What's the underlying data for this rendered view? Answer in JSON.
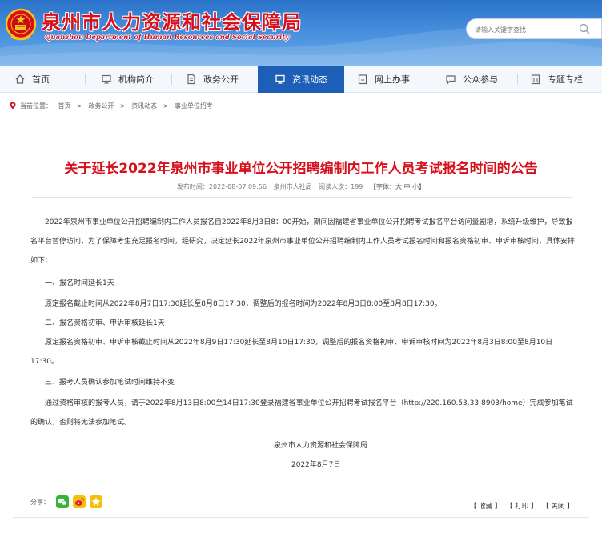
{
  "header": {
    "site_title": "泉州市人力资源和社会保障局",
    "site_subtitle": "Quanzhou Department of Human Resources and Social Security",
    "search_placeholder": "请输入关键字查找"
  },
  "nav": {
    "items": [
      {
        "label": "首页",
        "icon": "home-icon"
      },
      {
        "label": "机构简介",
        "icon": "monitor-icon"
      },
      {
        "label": "政务公开",
        "icon": "document-icon"
      },
      {
        "label": "资讯动态",
        "icon": "screen-icon",
        "active": true
      },
      {
        "label": "网上办事",
        "icon": "clipboard-icon"
      },
      {
        "label": "公众参与",
        "icon": "chat-icon"
      },
      {
        "label": "专题专栏",
        "icon": "column-icon"
      }
    ]
  },
  "breadcrumb": {
    "prefix": "当前位置：",
    "items": [
      "首页",
      "政务公开",
      "资讯动态",
      "事业单位招考"
    ],
    "separator": ">"
  },
  "article": {
    "title": "关于延长2022年泉州市事业单位公开招聘编制内工作人员考试报名时间的公告",
    "meta": {
      "published": "发布时间：2022-08-07 09:56",
      "source": "泉州市人社局",
      "views": "阅读人次：199",
      "font_size": "【字体：大 中 小】"
    },
    "paragraphs": [
      "2022年泉州市事业单位公开招聘编制内工作人员报名自2022年8月3日8：00开始，期间因福建省事业单位公开招聘考试报名平台访问量剧增，系统升级维护，导致报名平台暂停访问，为了保障考生充足报名时间，经研究，决定延长2022年泉州市事业单位公开招聘编制内工作人员考试报名时间和报名资格初审、申诉审核时间，具体安排如下：",
      "一、报名时间延长1天",
      "原定报名截止时间从2022年8月7日17:30延长至8月8日17:30，调整后的报名时间为2022年8月3日8:00至8月8日17:30。",
      "二、报名资格初审、申诉审核延长1天",
      "原定报名资格初审、申诉审核截止时间从2022年8月9日17:30延长至8月10日17:30，调整后的报名资格初审、申诉审核时间为2022年8月3日8:00至8月10日17:30。",
      "三、报考人员确认参加笔试时间维持不变",
      "通过资格审核的报考人员，请于2022年8月13日8:00至14日17:30登录福建省事业单位公开招聘考试报名平台（http://220.160.53.33:8903/home）完成参加笔试的确认，否则将无法参加笔试。"
    ],
    "signature": "泉州市人力资源和社会保障局",
    "date": "2022年8月7日"
  },
  "footer": {
    "share_label": "分享：",
    "share_icons": [
      "wechat-icon",
      "weibo-icon",
      "qzone-icon"
    ],
    "actions": [
      "【 收藏 】",
      "【 打印 】",
      "【 关闭 】"
    ]
  },
  "colors": {
    "title_red": "#d8101c",
    "nav_active": "#1d5fb6",
    "header_blue": "#2b73c9"
  }
}
